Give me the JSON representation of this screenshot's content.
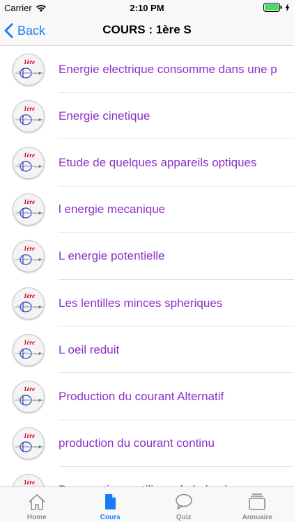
{
  "status_bar": {
    "carrier": "Carrier",
    "time": "2:10 PM"
  },
  "nav": {
    "back_label": "Back",
    "title": "COURS : 1ère S"
  },
  "list": {
    "thumb_badge": "1ère",
    "items": [
      {
        "label": "Energie electrique consomme dans une p"
      },
      {
        "label": "Energie cinetique"
      },
      {
        "label": "Etude de quelques appareils optiques"
      },
      {
        "label": "l energie mecanique"
      },
      {
        "label": "L energie potentielle"
      },
      {
        "label": "Les lentilles minces spheriques"
      },
      {
        "label": "L oeil reduit"
      },
      {
        "label": "Production du courant Alternatif"
      },
      {
        "label": "production du courant continu"
      },
      {
        "label": "Propagation rectiligne de la lumiere"
      }
    ]
  },
  "tab_bar": {
    "tabs": [
      {
        "label": "Home",
        "icon": "home-icon",
        "active": false
      },
      {
        "label": "Cours",
        "icon": "document-icon",
        "active": true
      },
      {
        "label": "Quiz",
        "icon": "chat-bubble-icon",
        "active": false
      },
      {
        "label": "Annuaire",
        "icon": "stack-icon",
        "active": false
      }
    ]
  },
  "colors": {
    "accent": "#1a7cf4",
    "item_text": "#8b2fc9",
    "badge": "#d0021b"
  }
}
